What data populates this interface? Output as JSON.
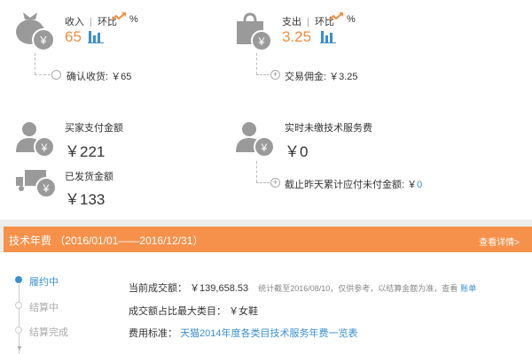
{
  "income": {
    "label": "收入",
    "sep": "|",
    "ring": "环比",
    "pct": "%",
    "value": "65",
    "detail": "确认收货: ￥65"
  },
  "expense": {
    "label": "支出",
    "sep": "|",
    "ring": "环比",
    "pct": "%",
    "value": "3.25",
    "detail": "交易佣金: ￥3.25"
  },
  "buyer_pay": {
    "label": "买家支付金额",
    "value": "￥221"
  },
  "shipped": {
    "label": "已发货金额",
    "value": "￥133"
  },
  "unpaid_fee": {
    "label": "实时未缴技术服务费",
    "value": "￥0",
    "detail_prefix": "截止昨天累计应付未付金额: ￥",
    "detail_value": "0"
  },
  "annual_fee": {
    "title": "技术年费 （2016/01/01——2016/12/31）",
    "view_details": "查看详情>",
    "steps": [
      "履约中",
      "结算中",
      "结算完成"
    ],
    "current_deal_label": "当前成交额：",
    "current_deal_value": "￥139,658.53",
    "stat_note": "统计截至2016/08/10，仅供参考，以结算金额为准，查看",
    "ledger_link": "账单",
    "top_category_label": "成交额占比最大类目：",
    "top_category_value": "￥女鞋",
    "fee_standard_label": "费用标准：",
    "fee_standard_link": "天猫2014年度各类目技术服务年费一览表"
  },
  "colors": {
    "accent": "#f18d3c",
    "link": "#3a8fd0",
    "icon": "#9a9a9a",
    "banner": "#f5914a"
  }
}
